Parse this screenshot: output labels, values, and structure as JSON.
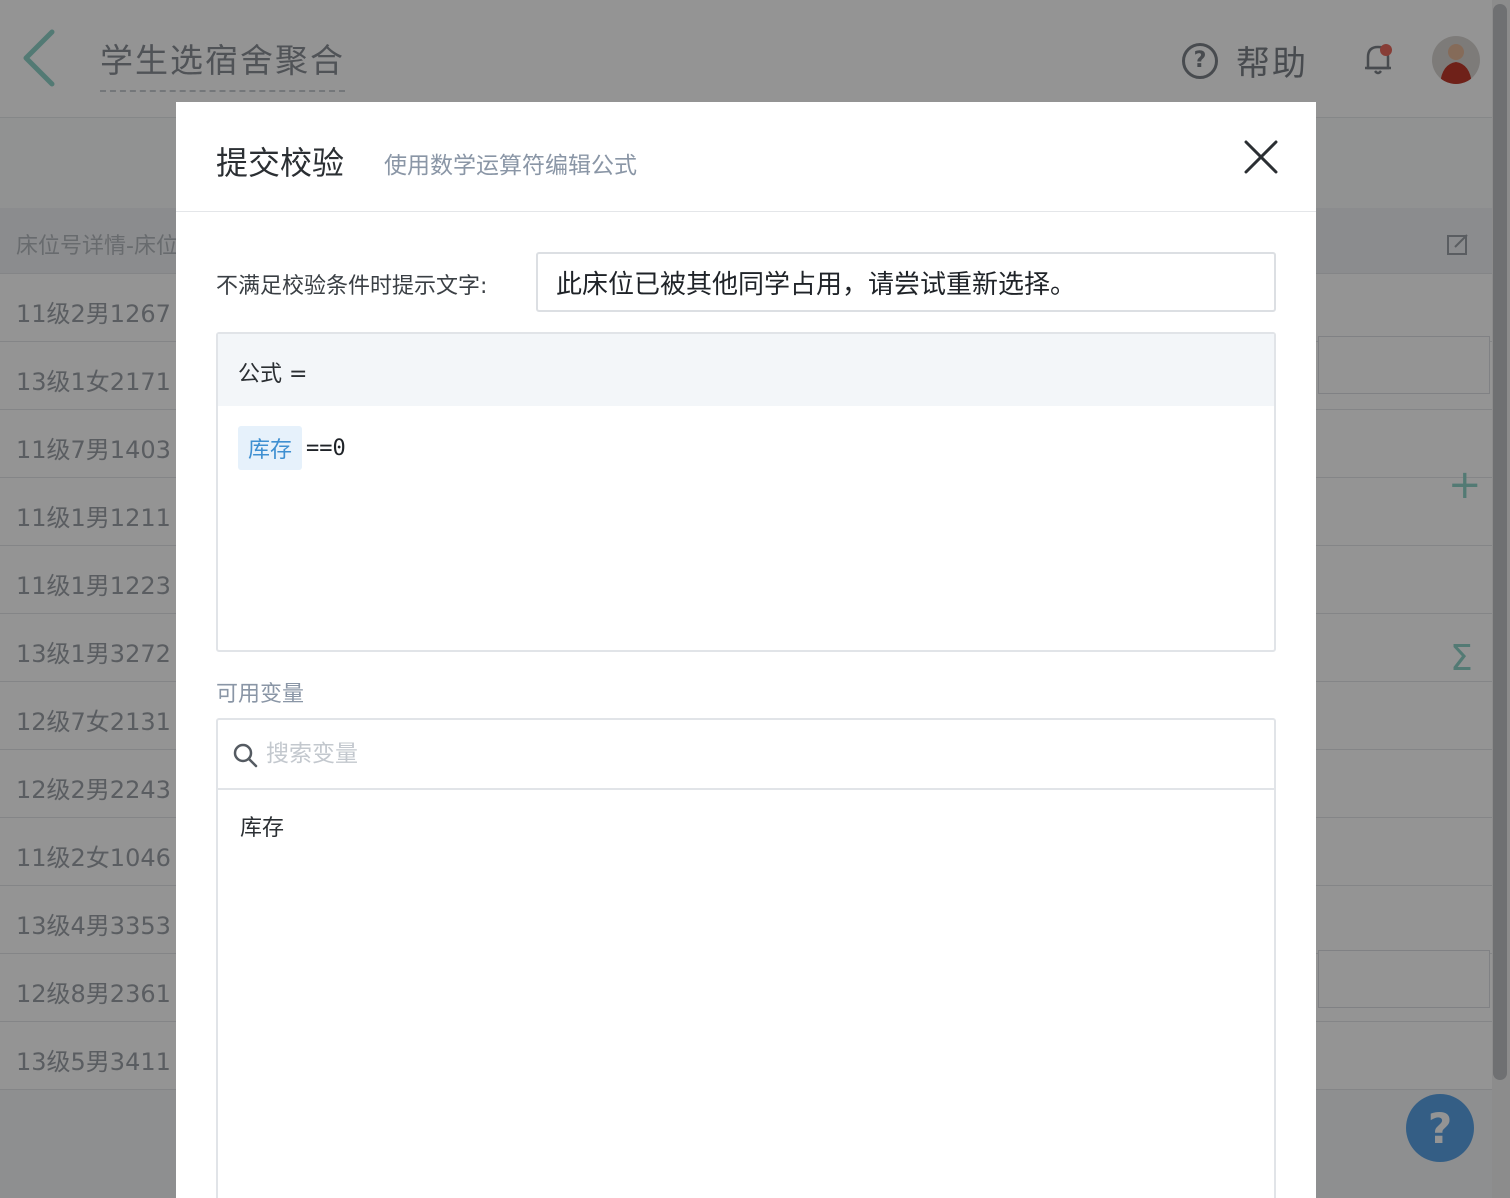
{
  "app": {
    "title": "学生选宿舍聚合",
    "help_label": "帮助",
    "help_glyph": "?",
    "list_header": "床位号详情-床位",
    "rows": [
      "11级2男1267",
      "13级1女2171",
      "11级7男1403",
      "11级1男1211",
      "11级1男1223",
      "13级1男3272",
      "12级7女2131",
      "12级2男2243",
      "11级2女1046",
      "13级4男3353",
      "12级8男2361",
      "13级5男3411"
    ],
    "side_plus": "+",
    "side_sigma": "Σ",
    "float_help": "?"
  },
  "modal": {
    "title": "提交校验",
    "subtitle": "使用数学运算符编辑公式",
    "tip_label": "不满足校验条件时提示文字:",
    "tip_value": "此床位已被其他同学占用，请尝试重新选择。",
    "formula_label": "公式 =",
    "formula_var": "库存",
    "formula_expr": "==0",
    "vars_label": "可用变量",
    "search_placeholder": "搜索变量",
    "variables": [
      "库存"
    ]
  },
  "colors": {
    "accent_teal": "#8fd3c8",
    "chip_bg": "#e6f1fb",
    "chip_text": "#3e8fd1",
    "float_help_bg": "#5aa3e6"
  }
}
